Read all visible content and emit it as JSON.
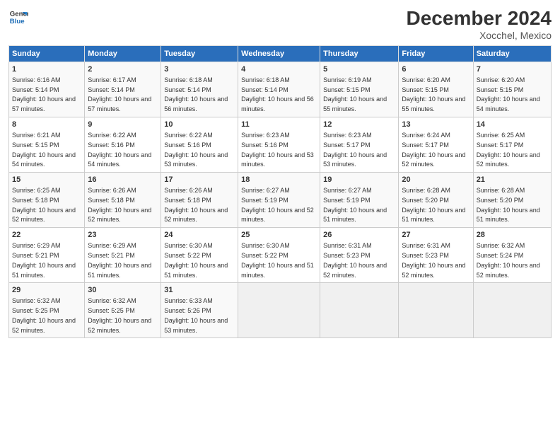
{
  "logo": {
    "line1": "General",
    "line2": "Blue"
  },
  "title": "December 2024",
  "subtitle": "Xocchel, Mexico",
  "headers": [
    "Sunday",
    "Monday",
    "Tuesday",
    "Wednesday",
    "Thursday",
    "Friday",
    "Saturday"
  ],
  "weeks": [
    [
      {
        "day": "1",
        "sunrise": "6:16 AM",
        "sunset": "5:14 PM",
        "daylight": "10 hours and 57 minutes."
      },
      {
        "day": "2",
        "sunrise": "6:17 AM",
        "sunset": "5:14 PM",
        "daylight": "10 hours and 57 minutes."
      },
      {
        "day": "3",
        "sunrise": "6:18 AM",
        "sunset": "5:14 PM",
        "daylight": "10 hours and 56 minutes."
      },
      {
        "day": "4",
        "sunrise": "6:18 AM",
        "sunset": "5:14 PM",
        "daylight": "10 hours and 56 minutes."
      },
      {
        "day": "5",
        "sunrise": "6:19 AM",
        "sunset": "5:15 PM",
        "daylight": "10 hours and 55 minutes."
      },
      {
        "day": "6",
        "sunrise": "6:20 AM",
        "sunset": "5:15 PM",
        "daylight": "10 hours and 55 minutes."
      },
      {
        "day": "7",
        "sunrise": "6:20 AM",
        "sunset": "5:15 PM",
        "daylight": "10 hours and 54 minutes."
      }
    ],
    [
      {
        "day": "8",
        "sunrise": "6:21 AM",
        "sunset": "5:15 PM",
        "daylight": "10 hours and 54 minutes."
      },
      {
        "day": "9",
        "sunrise": "6:22 AM",
        "sunset": "5:16 PM",
        "daylight": "10 hours and 54 minutes."
      },
      {
        "day": "10",
        "sunrise": "6:22 AM",
        "sunset": "5:16 PM",
        "daylight": "10 hours and 53 minutes."
      },
      {
        "day": "11",
        "sunrise": "6:23 AM",
        "sunset": "5:16 PM",
        "daylight": "10 hours and 53 minutes."
      },
      {
        "day": "12",
        "sunrise": "6:23 AM",
        "sunset": "5:17 PM",
        "daylight": "10 hours and 53 minutes."
      },
      {
        "day": "13",
        "sunrise": "6:24 AM",
        "sunset": "5:17 PM",
        "daylight": "10 hours and 52 minutes."
      },
      {
        "day": "14",
        "sunrise": "6:25 AM",
        "sunset": "5:17 PM",
        "daylight": "10 hours and 52 minutes."
      }
    ],
    [
      {
        "day": "15",
        "sunrise": "6:25 AM",
        "sunset": "5:18 PM",
        "daylight": "10 hours and 52 minutes."
      },
      {
        "day": "16",
        "sunrise": "6:26 AM",
        "sunset": "5:18 PM",
        "daylight": "10 hours and 52 minutes."
      },
      {
        "day": "17",
        "sunrise": "6:26 AM",
        "sunset": "5:18 PM",
        "daylight": "10 hours and 52 minutes."
      },
      {
        "day": "18",
        "sunrise": "6:27 AM",
        "sunset": "5:19 PM",
        "daylight": "10 hours and 52 minutes."
      },
      {
        "day": "19",
        "sunrise": "6:27 AM",
        "sunset": "5:19 PM",
        "daylight": "10 hours and 51 minutes."
      },
      {
        "day": "20",
        "sunrise": "6:28 AM",
        "sunset": "5:20 PM",
        "daylight": "10 hours and 51 minutes."
      },
      {
        "day": "21",
        "sunrise": "6:28 AM",
        "sunset": "5:20 PM",
        "daylight": "10 hours and 51 minutes."
      }
    ],
    [
      {
        "day": "22",
        "sunrise": "6:29 AM",
        "sunset": "5:21 PM",
        "daylight": "10 hours and 51 minutes."
      },
      {
        "day": "23",
        "sunrise": "6:29 AM",
        "sunset": "5:21 PM",
        "daylight": "10 hours and 51 minutes."
      },
      {
        "day": "24",
        "sunrise": "6:30 AM",
        "sunset": "5:22 PM",
        "daylight": "10 hours and 51 minutes."
      },
      {
        "day": "25",
        "sunrise": "6:30 AM",
        "sunset": "5:22 PM",
        "daylight": "10 hours and 51 minutes."
      },
      {
        "day": "26",
        "sunrise": "6:31 AM",
        "sunset": "5:23 PM",
        "daylight": "10 hours and 52 minutes."
      },
      {
        "day": "27",
        "sunrise": "6:31 AM",
        "sunset": "5:23 PM",
        "daylight": "10 hours and 52 minutes."
      },
      {
        "day": "28",
        "sunrise": "6:32 AM",
        "sunset": "5:24 PM",
        "daylight": "10 hours and 52 minutes."
      }
    ],
    [
      {
        "day": "29",
        "sunrise": "6:32 AM",
        "sunset": "5:25 PM",
        "daylight": "10 hours and 52 minutes."
      },
      {
        "day": "30",
        "sunrise": "6:32 AM",
        "sunset": "5:25 PM",
        "daylight": "10 hours and 52 minutes."
      },
      {
        "day": "31",
        "sunrise": "6:33 AM",
        "sunset": "5:26 PM",
        "daylight": "10 hours and 53 minutes."
      },
      null,
      null,
      null,
      null
    ]
  ]
}
